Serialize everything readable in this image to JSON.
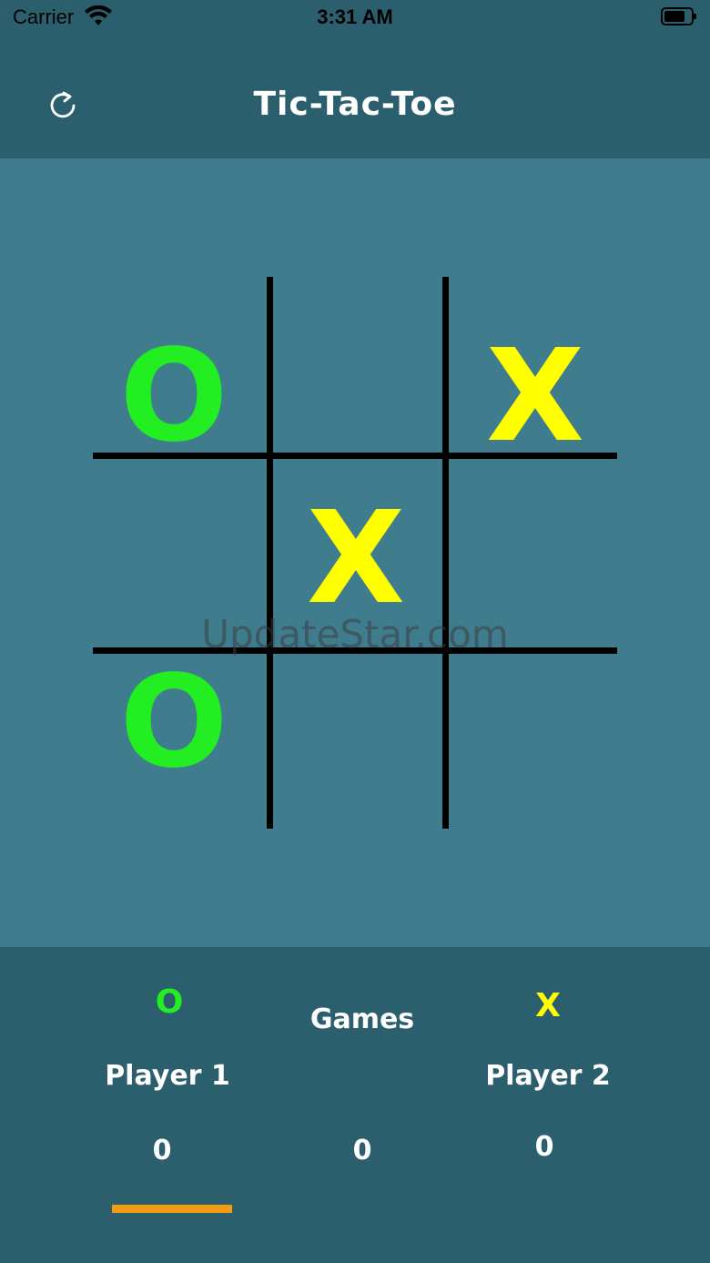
{
  "status_bar": {
    "carrier": "Carrier",
    "time": "3:31 AM"
  },
  "nav": {
    "title": "Tic-Tac-Toe",
    "refresh_icon": "refresh-icon"
  },
  "board": {
    "cells": [
      "O",
      "",
      "X",
      "",
      "X",
      "",
      "O",
      "",
      ""
    ]
  },
  "watermark": "UpdateStar.com",
  "colors": {
    "o": "#22ee22",
    "x": "#ffff00",
    "indicator": "#f39c12"
  },
  "score": {
    "player1": {
      "symbol": "O",
      "name": "Player 1",
      "score": "0"
    },
    "games": {
      "label": "Games",
      "score": "0"
    },
    "player2": {
      "symbol": "X",
      "name": "Player 2",
      "score": "0"
    }
  }
}
